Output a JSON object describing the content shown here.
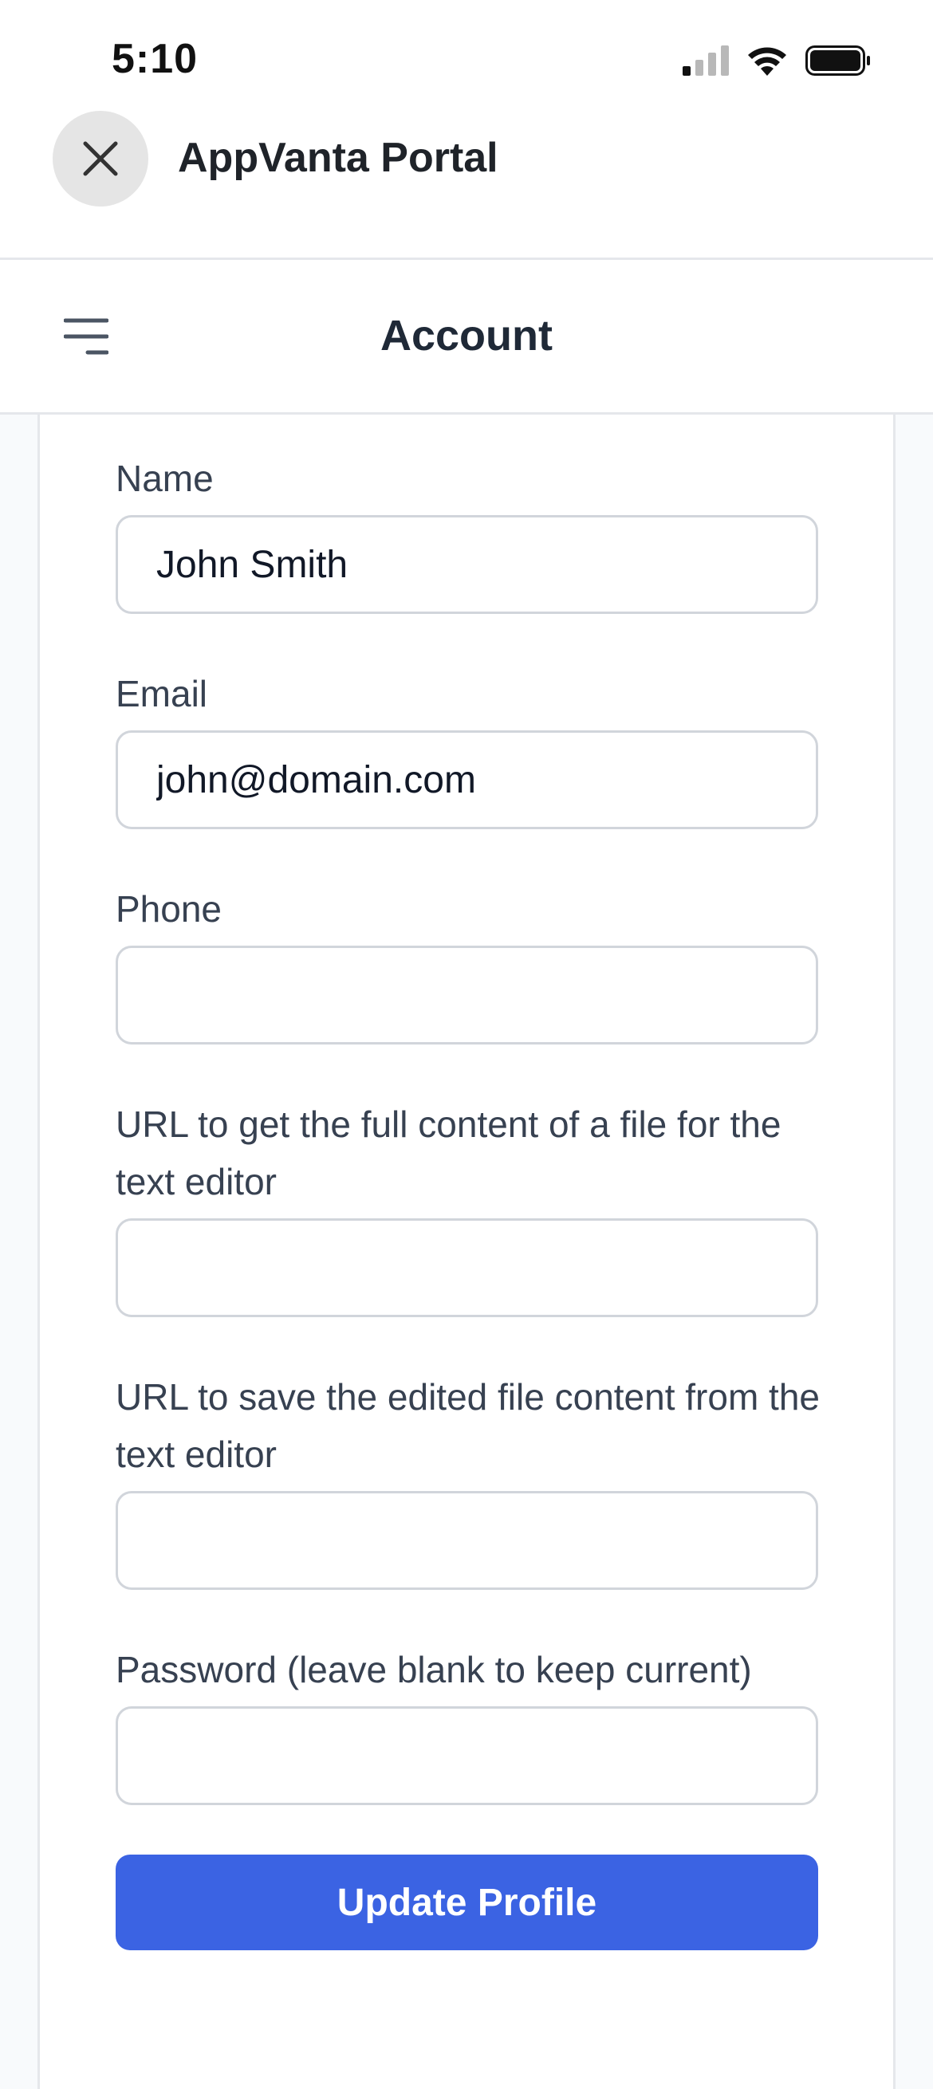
{
  "status_bar": {
    "time": "5:10",
    "icons": [
      "signal-icon",
      "wifi-icon",
      "battery-icon"
    ]
  },
  "browser": {
    "close_icon": "close-icon",
    "title": "AppVanta Portal"
  },
  "header": {
    "menu_icon": "hamburger-menu-icon",
    "title": "Account"
  },
  "form": {
    "fields": [
      {
        "label": "Name",
        "value": "John Smith",
        "placeholder": ""
      },
      {
        "label": "Email",
        "value": "john@domain.com",
        "placeholder": ""
      },
      {
        "label": "Phone",
        "value": "",
        "placeholder": ""
      },
      {
        "label": "URL to get the full content of a file for the text editor",
        "value": "",
        "placeholder": ""
      },
      {
        "label": "URL to save the edited file content from the text editor",
        "value": "",
        "placeholder": ""
      },
      {
        "label": "Password (leave blank to keep current)",
        "value": "",
        "placeholder": ""
      }
    ],
    "submit_label": "Update Profile"
  },
  "colors": {
    "primary": "#3b63e3",
    "background": "#f8fafc",
    "border": "#d1d5db"
  }
}
